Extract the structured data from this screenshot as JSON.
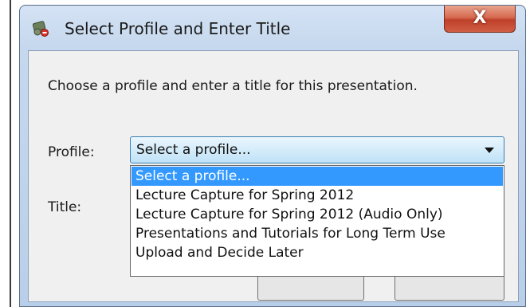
{
  "window": {
    "title": "Select Profile and Enter Title",
    "close_glyph": "X",
    "app_icon": "app-icon",
    "close_icon": "close-icon"
  },
  "dialog": {
    "instructions": "Choose a profile and enter a title for this presentation.",
    "profile_label": "Profile:",
    "title_label": "Title:",
    "profile_select": {
      "selected": "Select a profile...",
      "options": [
        "Select a profile...",
        "Lecture Capture for Spring 2012",
        "Lecture Capture for Spring 2012 (Audio Only)",
        "Presentations and Tutorials for Long Term Use",
        "Upload and Decide Later"
      ],
      "highlighted_index": 0
    }
  },
  "colors": {
    "highlight": "#3399ff",
    "close_button": "#c0402a",
    "select_border": "#3c7fb1"
  }
}
